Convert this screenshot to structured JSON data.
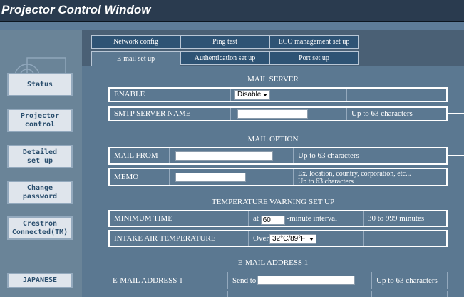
{
  "window": {
    "title": "Projector Control Window"
  },
  "sidebar": {
    "items": [
      {
        "label": "Status"
      },
      {
        "label": "Projector\ncontrol"
      },
      {
        "label": "Detailed\nset up"
      },
      {
        "label": "Change\npassword"
      },
      {
        "label": "Crestron\nConnected(TM)"
      },
      {
        "label": "JAPANESE"
      }
    ]
  },
  "tabs": {
    "row1": [
      "Network config",
      "Ping test",
      "ECO management set up"
    ],
    "row2": [
      "E-mail set up",
      "Authentication set up",
      "Port set up"
    ]
  },
  "mail_server": {
    "heading": "MAIL SERVER",
    "enable_label": "ENABLE",
    "enable_value": "Disable",
    "smtp_label": "SMTP SERVER NAME",
    "smtp_value": "",
    "smtp_note": "Up to 63 characters"
  },
  "mail_option": {
    "heading": "MAIL OPTION",
    "from_label": "MAIL FROM",
    "from_value": "",
    "from_note": "Up to 63 characters",
    "memo_label": "MEMO",
    "memo_value": "",
    "memo_note_1": "Ex. location, country, corporation, etc...",
    "memo_note_2": "Up to 63 characters"
  },
  "temperature": {
    "heading": "TEMPERATURE WARNING SET UP",
    "min_time_label": "MINIMUM TIME",
    "at_text": "at",
    "min_time_value": "60",
    "interval_text": "-minute interval",
    "min_time_note": "30 to 999 minutes",
    "intake_label": "INTAKE AIR TEMPERATURE",
    "over_text": "Over",
    "intake_value": "32°C/89°F"
  },
  "email_address": {
    "heading": "E-MAIL ADDRESS 1",
    "address1_label": "E-MAIL ADDRESS 1",
    "send_to_text": "Send to",
    "address1_value": "",
    "address1_note": "Up to 63 characters"
  }
}
